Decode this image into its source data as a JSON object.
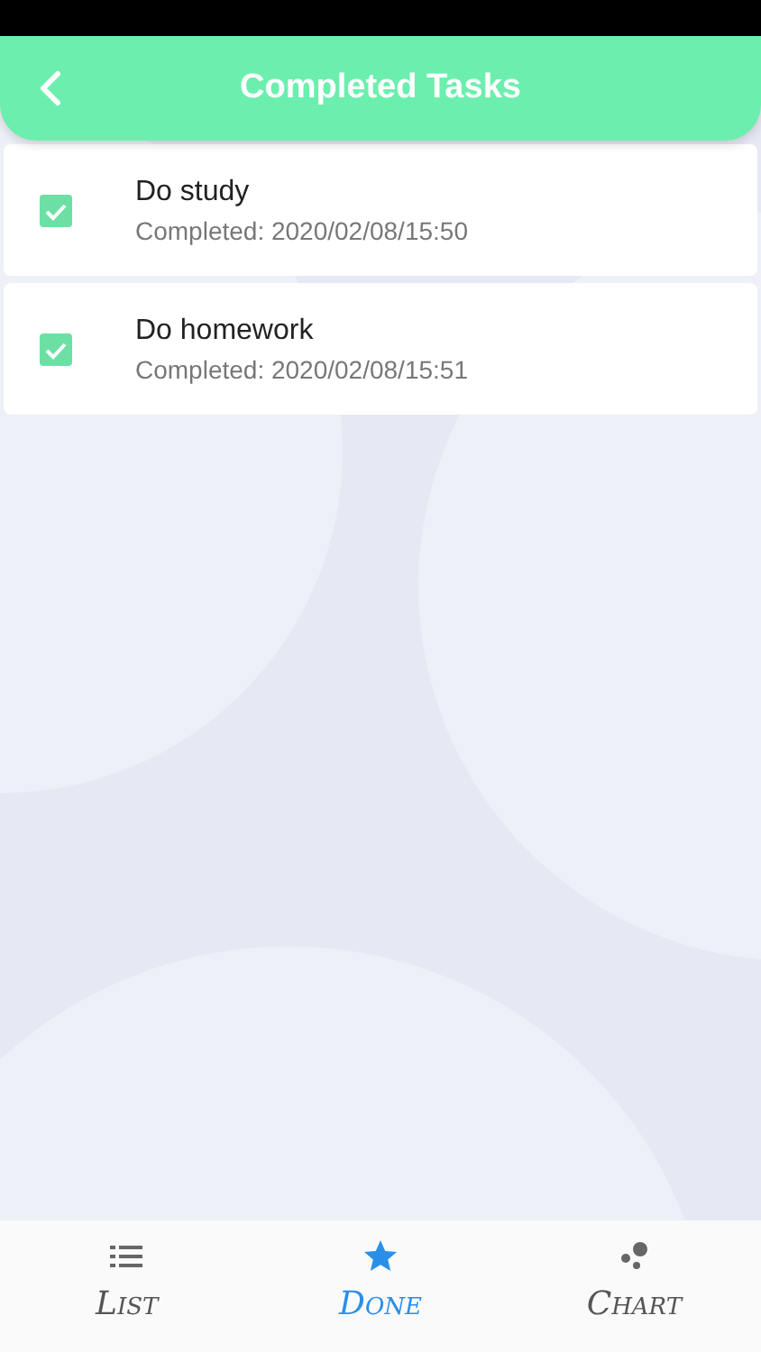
{
  "header": {
    "title": "Completed Tasks"
  },
  "tasks": [
    {
      "name": "Do study",
      "completed": "Completed: 2020/02/08/15:50",
      "checked": true
    },
    {
      "name": "Do homework",
      "completed": "Completed: 2020/02/08/15:51",
      "checked": true
    }
  ],
  "tabs": [
    {
      "label": "List",
      "kind": "list",
      "selected": false
    },
    {
      "label": "Done",
      "kind": "star",
      "selected": true
    },
    {
      "label": "Chart",
      "kind": "chart",
      "selected": false
    }
  ]
}
